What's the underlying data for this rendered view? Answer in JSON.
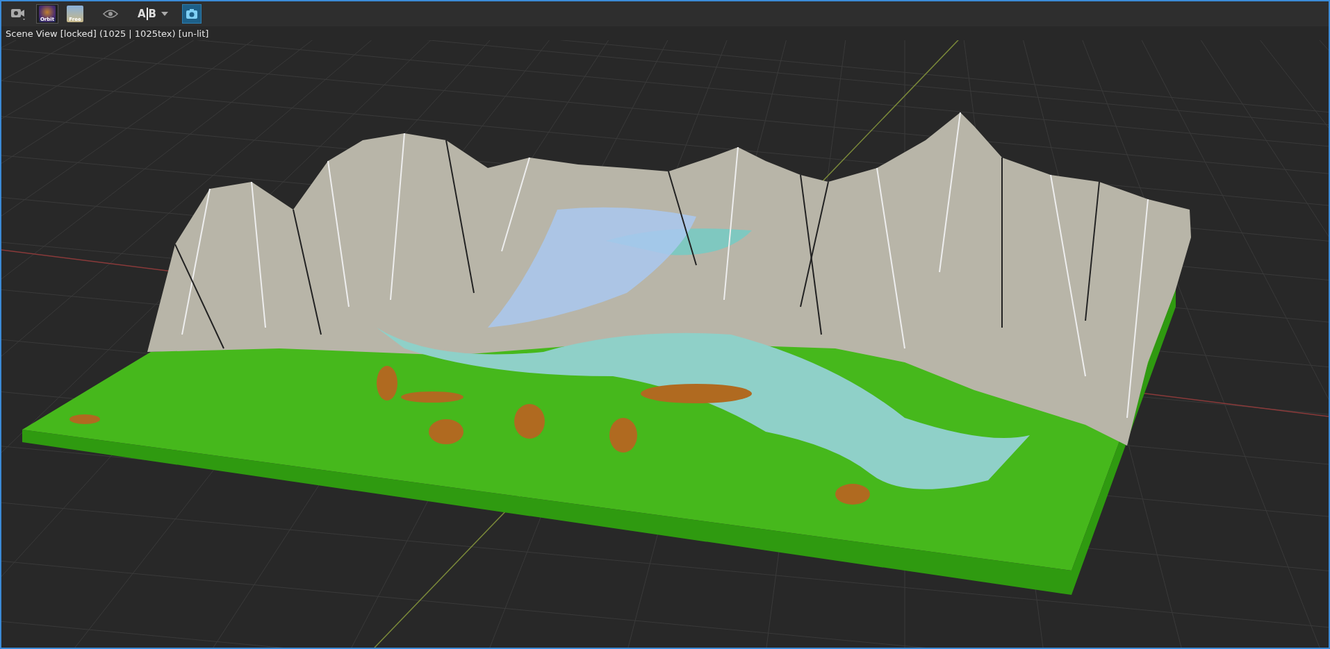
{
  "toolbar": [
    {
      "kind": "camera_menu"
    },
    {
      "kind": "orbit",
      "label": "Orbit",
      "selected": true
    },
    {
      "kind": "free",
      "label": "Free",
      "selected": false
    },
    {
      "kind": "eye"
    },
    {
      "kind": "ab",
      "label_a": "A",
      "label_b": "B"
    },
    {
      "kind": "snapshot"
    }
  ],
  "viewport": {
    "status": "Scene View [locked] (1025 | 1025tex)  [un-lit]"
  }
}
